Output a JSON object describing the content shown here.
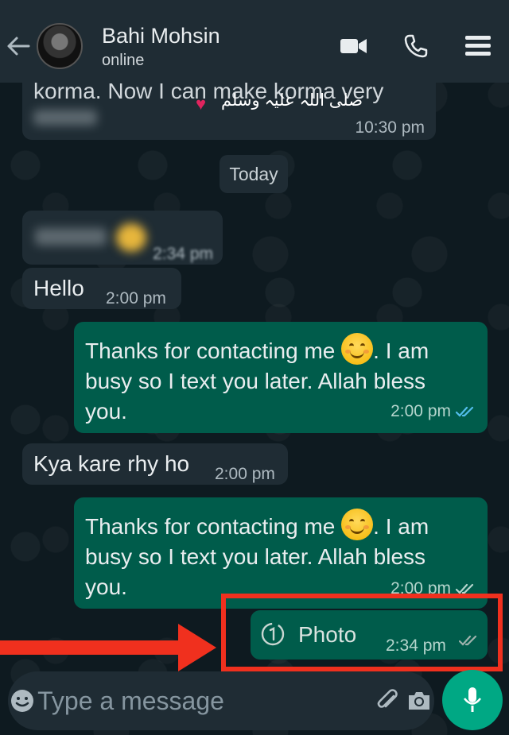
{
  "header": {
    "contact_name": "Bahi Mohsin",
    "status": "online"
  },
  "messages": {
    "top_partial": {
      "text": "korma. Now I can make korma very",
      "overlay_text": "صلی اللہ علیہ وسلم",
      "time": "10:30 pm"
    },
    "date_chip": "Today",
    "blurred_in": {
      "time": "2:34 pm"
    },
    "hello": {
      "text": "Hello",
      "time": "2:00 pm"
    },
    "out1": {
      "text_before_emoji": "Thanks for contacting me ",
      "text_after_emoji": ". I am busy so I text you later. Allah bless you.",
      "time": "2:00 pm",
      "status_icon": "double-check-read"
    },
    "kya": {
      "text": "Kya kare rhy ho",
      "time": "2:00 pm"
    },
    "out2": {
      "text_before_emoji": "Thanks for contacting me ",
      "text_after_emoji": ". I am busy so I text you later. Allah bless you.",
      "time": "2:00 pm"
    },
    "photo": {
      "label": "Photo",
      "time": "2:34 pm",
      "icon": "view-once-icon",
      "status_icon": "double-check-delivered"
    }
  },
  "composer": {
    "placeholder": "Type a message"
  },
  "colors": {
    "header_bg": "#1f2c34",
    "incoming_bg": "#1f2c34",
    "outgoing_bg": "#005c4b",
    "read_tick": "#53bdeb",
    "mic_bg": "#00a884",
    "annotation_red": "#f0301e"
  }
}
